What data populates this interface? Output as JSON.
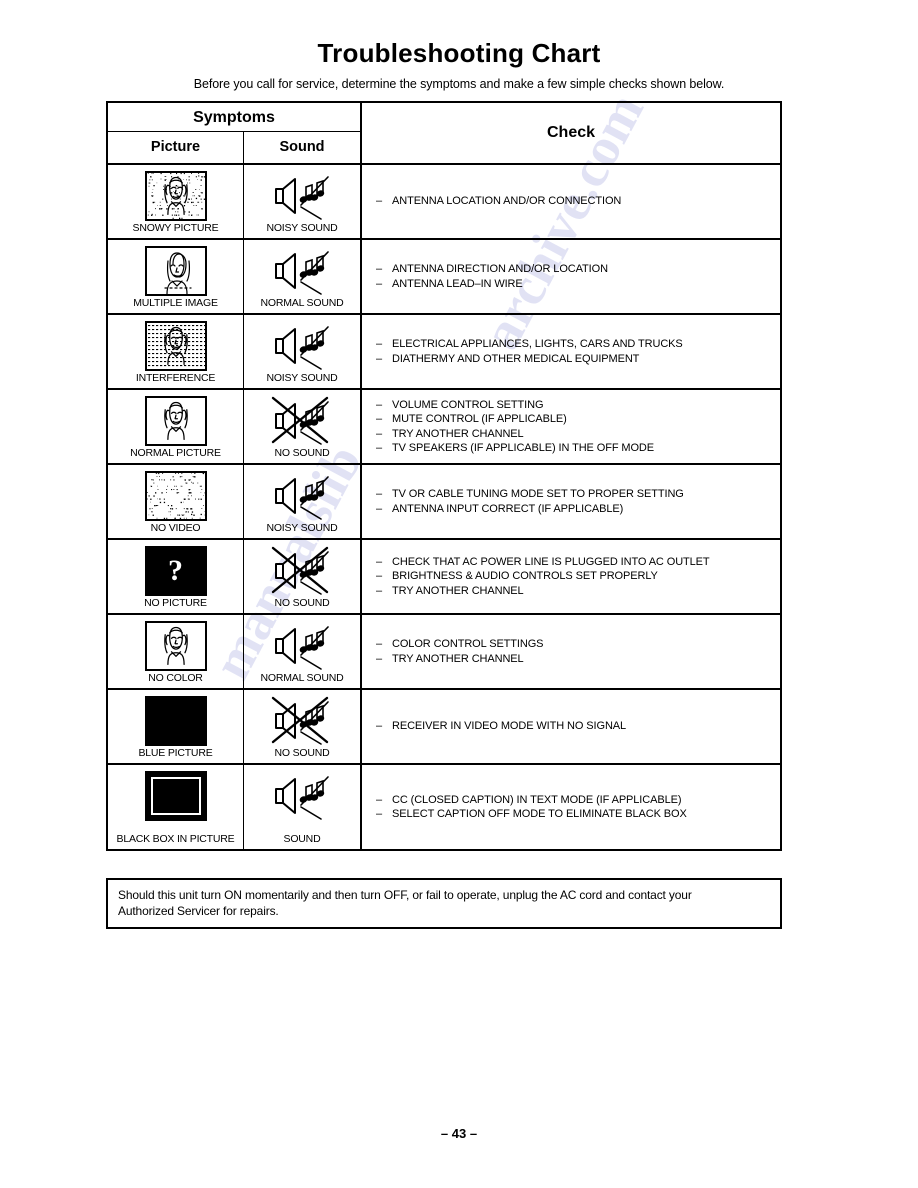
{
  "document": {
    "title": "Troubleshooting Chart",
    "subtitle": "Before you call for service, determine the symptoms and make a few simple checks shown below.",
    "page_number": "– 43 –",
    "watermark_1": "archive.com",
    "watermark_2": "manualslib"
  },
  "table": {
    "head": {
      "symptoms": "Symptoms",
      "picture": "Picture",
      "sound": "Sound",
      "check": "Check"
    },
    "rows": [
      {
        "picture_label": "SNOWY PICTURE",
        "picture_icon": "tv-snowy-face-icon",
        "sound_label": "NOISY SOUND",
        "sound_icon": "speaker-noisy-icon",
        "checks": [
          "ANTENNA LOCATION AND/OR CONNECTION"
        ]
      },
      {
        "picture_label": "MULTIPLE IMAGE",
        "picture_icon": "tv-ghost-face-icon",
        "sound_label": "NORMAL SOUND",
        "sound_icon": "speaker-normal-icon",
        "checks": [
          "ANTENNA DIRECTION AND/OR LOCATION",
          "ANTENNA LEAD–IN WIRE"
        ]
      },
      {
        "picture_label": "INTERFERENCE",
        "picture_icon": "tv-interference-face-icon",
        "sound_label": "NOISY SOUND",
        "sound_icon": "speaker-noisy-icon",
        "checks": [
          "ELECTRICAL APPLIANCES, LIGHTS, CARS AND TRUCKS",
          "DIATHERMY AND OTHER MEDICAL EQUIPMENT"
        ]
      },
      {
        "picture_label": "NORMAL PICTURE",
        "picture_icon": "tv-normal-face-icon",
        "sound_label": "NO SOUND",
        "sound_icon": "speaker-muted-icon",
        "checks": [
          "VOLUME CONTROL SETTING",
          "MUTE CONTROL (IF APPLICABLE)",
          "TRY ANOTHER CHANNEL",
          "TV SPEAKERS (IF APPLICABLE) IN THE OFF MODE"
        ]
      },
      {
        "picture_label": "NO VIDEO",
        "picture_icon": "tv-no-video-icon",
        "sound_label": "NOISY SOUND",
        "sound_icon": "speaker-noisy-icon",
        "checks": [
          "TV OR CABLE TUNING MODE SET TO PROPER SETTING",
          "ANTENNA INPUT CORRECT (IF APPLICABLE)"
        ]
      },
      {
        "picture_label": "NO PICTURE",
        "picture_icon": "tv-question-mark-icon",
        "sound_label": "NO SOUND",
        "sound_icon": "speaker-muted-icon",
        "checks": [
          "CHECK THAT AC POWER LINE  IS PLUGGED  INTO AC OUTLET",
          "BRIGHTNESS & AUDIO CONTROLS SET PROPERLY",
          "TRY ANOTHER CHANNEL"
        ]
      },
      {
        "picture_label": "NO COLOR",
        "picture_icon": "tv-no-color-face-icon",
        "sound_label": "NORMAL SOUND",
        "sound_icon": "speaker-normal-icon",
        "checks": [
          "COLOR CONTROL SETTINGS",
          "TRY ANOTHER CHANNEL"
        ]
      },
      {
        "picture_label": "BLUE PICTURE",
        "picture_icon": "tv-blank-screen-icon",
        "sound_label": "NO SOUND",
        "sound_icon": "speaker-muted-icon",
        "checks": [
          "RECEIVER IN VIDEO MODE WITH NO SIGNAL"
        ]
      },
      {
        "picture_label": "BLACK BOX IN PICTURE",
        "picture_icon": "tv-black-box-icon",
        "sound_label": "SOUND",
        "sound_icon": "speaker-normal-icon",
        "checks": [
          "CC (CLOSED CAPTION) IN TEXT MODE (IF APPLICABLE)",
          "SELECT CAPTION OFF MODE TO ELIMINATE BLACK BOX"
        ]
      }
    ]
  },
  "note": {
    "line1": "Should this unit turn ON momentarily and then turn OFF, or fail to operate, unplug the AC cord and contact your",
    "line2": "Authorized Servicer for repairs."
  }
}
